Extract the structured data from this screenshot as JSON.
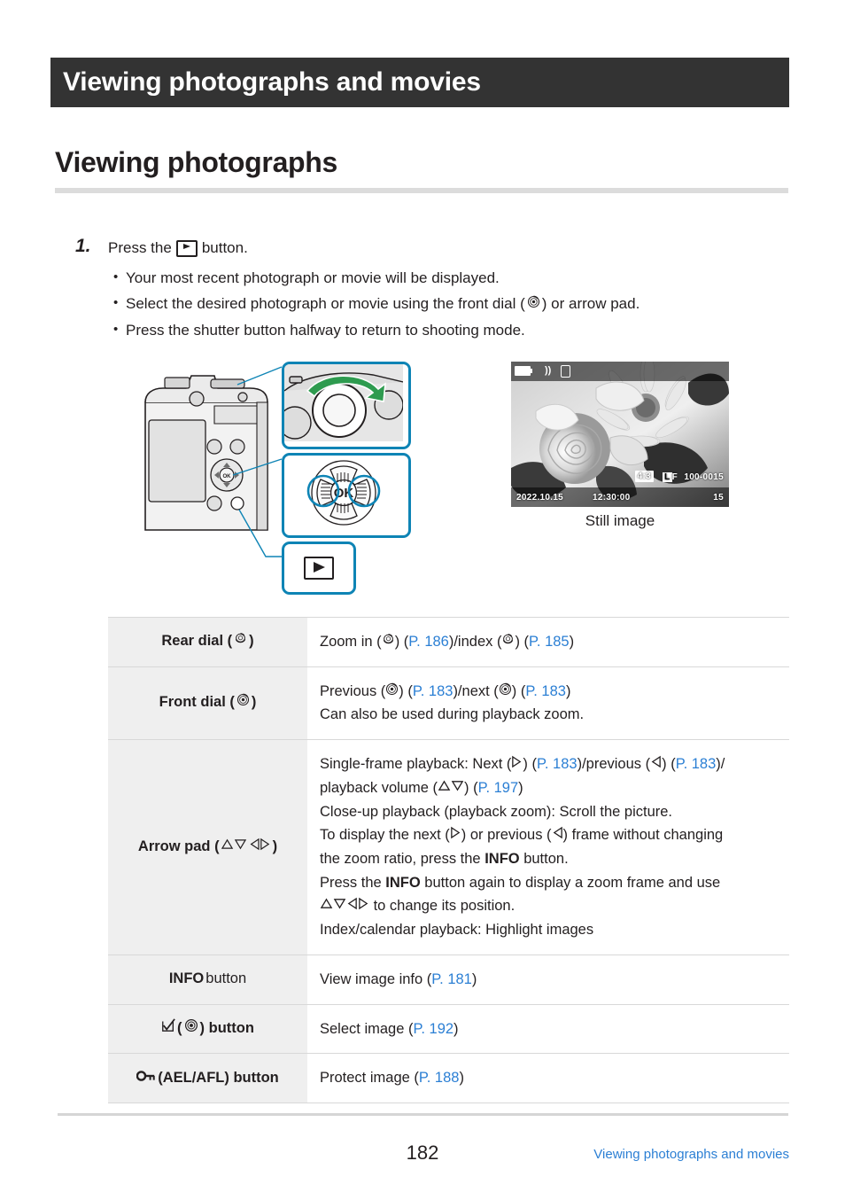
{
  "chapter": {
    "banner_title": "Viewing photographs and movies"
  },
  "section": {
    "title": "Viewing photographs"
  },
  "step": {
    "number": "1.",
    "text_before": "Press the",
    "icon": "playback-button-icon",
    "text_after": "button.",
    "bullets": [
      "Your most recent photograph or movie will be displayed.",
      {
        "before": "Select the desired photograph or movie using the front dial (",
        "icon": "front-dial-icon",
        "after": ") or arrow pad."
      },
      "Press the shutter button halfway to return to shooting mode."
    ]
  },
  "figure": {
    "caption": "Still image",
    "camera_alt": "camera-rear-view",
    "callouts": [
      "front-dial-detail",
      "arrow-pad-detail",
      "playback-button-detail"
    ],
    "lcd_overlay": {
      "battery": "battery-icon",
      "wifi": "wifi-icon",
      "phone": "smartphone-icon",
      "aspect": "4:3",
      "quality_l": "L",
      "quality_f": "F",
      "file_number": "100-0015",
      "date": "2022.10.15",
      "time": "12:30:00",
      "frame_count": "15"
    }
  },
  "table": {
    "rows": [
      {
        "key_text": "Rear dial (",
        "key_icon": "rear-dial-icon",
        "key_tail": ")",
        "lines": [
          [
            {
              "t": "text",
              "v": "Zoom in ("
            },
            {
              "t": "icon",
              "v": "rear-dial-icon"
            },
            {
              "t": "text",
              "v": ") ("
            },
            {
              "t": "ref",
              "v": "P. 186"
            },
            {
              "t": "text",
              "v": ")/index ("
            },
            {
              "t": "icon",
              "v": "rear-dial-icon"
            },
            {
              "t": "text",
              "v": ") ("
            },
            {
              "t": "ref",
              "v": "P. 185"
            },
            {
              "t": "text",
              "v": ")"
            }
          ]
        ]
      },
      {
        "key_text": "Front dial (",
        "key_icon": "front-dial-icon",
        "key_tail": ")",
        "lines": [
          [
            {
              "t": "text",
              "v": "Previous ("
            },
            {
              "t": "icon",
              "v": "front-dial-icon"
            },
            {
              "t": "text",
              "v": ") ("
            },
            {
              "t": "ref",
              "v": "P. 183"
            },
            {
              "t": "text",
              "v": ")/next ("
            },
            {
              "t": "icon",
              "v": "front-dial-icon"
            },
            {
              "t": "text",
              "v": ") ("
            },
            {
              "t": "ref",
              "v": "P. 183"
            },
            {
              "t": "text",
              "v": ")"
            }
          ],
          [
            {
              "t": "text",
              "v": "Can also be used during playback zoom."
            }
          ]
        ]
      },
      {
        "key_text": "Arrow pad (",
        "key_icon": "arrow-pad-icons",
        "key_tail": ")",
        "lines": [
          [
            {
              "t": "text",
              "v": "Single-frame playback: Next ("
            },
            {
              "t": "icon",
              "v": "right-triangle-icon"
            },
            {
              "t": "text",
              "v": ") ("
            },
            {
              "t": "ref",
              "v": "P. 183"
            },
            {
              "t": "text",
              "v": ")/previous ("
            },
            {
              "t": "icon",
              "v": "left-triangle-icon"
            },
            {
              "t": "text",
              "v": ") ("
            },
            {
              "t": "ref",
              "v": "P. 183"
            },
            {
              "t": "text",
              "v": ")/"
            }
          ],
          [
            {
              "t": "text",
              "v": "playback volume ("
            },
            {
              "t": "icon",
              "v": "up-triangle-icon"
            },
            {
              "t": "icon",
              "v": "down-triangle-icon"
            },
            {
              "t": "text",
              "v": ") ("
            },
            {
              "t": "ref",
              "v": "P. 197"
            },
            {
              "t": "text",
              "v": ")"
            }
          ],
          [
            {
              "t": "text",
              "v": "Close-up playback (playback zoom): Scroll the picture."
            }
          ],
          [
            {
              "t": "text",
              "v": "To display the next ("
            },
            {
              "t": "icon",
              "v": "right-triangle-icon"
            },
            {
              "t": "text",
              "v": ") or previous ("
            },
            {
              "t": "icon",
              "v": "left-triangle-icon"
            },
            {
              "t": "text",
              "v": ") frame without changing"
            }
          ],
          [
            {
              "t": "text",
              "v": "the zoom ratio, press the "
            },
            {
              "t": "bold",
              "v": "INFO"
            },
            {
              "t": "text",
              "v": " button."
            }
          ],
          [
            {
              "t": "text",
              "v": "Press the "
            },
            {
              "t": "bold",
              "v": "INFO"
            },
            {
              "t": "text",
              "v": " button again to display a zoom frame and use"
            }
          ],
          [
            {
              "t": "icon",
              "v": "up-triangle-icon"
            },
            {
              "t": "icon",
              "v": "down-triangle-icon"
            },
            {
              "t": "icon",
              "v": "left-triangle-icon"
            },
            {
              "t": "icon",
              "v": "right-triangle-icon"
            },
            {
              "t": "text",
              "v": " to change its position."
            }
          ],
          [
            {
              "t": "text",
              "v": "Index/calendar playback: Highlight images"
            }
          ]
        ]
      },
      {
        "key_bold": "INFO",
        "key_text2": " button",
        "lines": [
          [
            {
              "t": "text",
              "v": "View image info ("
            },
            {
              "t": "ref",
              "v": "P. 181"
            },
            {
              "t": "text",
              "v": ")"
            }
          ]
        ]
      },
      {
        "key_checkbox": "checkmark-box-icon",
        "key_icon": "multi-selector-icon",
        "key_text2": " button",
        "lines": [
          [
            {
              "t": "text",
              "v": "Select image ("
            },
            {
              "t": "ref",
              "v": "P. 192"
            },
            {
              "t": "text",
              "v": ")"
            }
          ]
        ]
      },
      {
        "key_lock": "key-lock-icon",
        "key_text2": "(AEL/AFL) button",
        "lines": [
          [
            {
              "t": "text",
              "v": "Protect image ("
            },
            {
              "t": "ref",
              "v": "P. 188"
            },
            {
              "t": "text",
              "v": ")"
            }
          ]
        ]
      }
    ]
  },
  "footer": {
    "page_number": "182",
    "link_text": "Viewing photographs and movies"
  },
  "colors": {
    "banner_bg": "#333333",
    "link": "#2b7fd4",
    "rule": "#dcdcdc",
    "key_cell_bg": "#efefef",
    "callout_blue": "#0e84b5",
    "arrow_green": "#2e9b4f"
  }
}
